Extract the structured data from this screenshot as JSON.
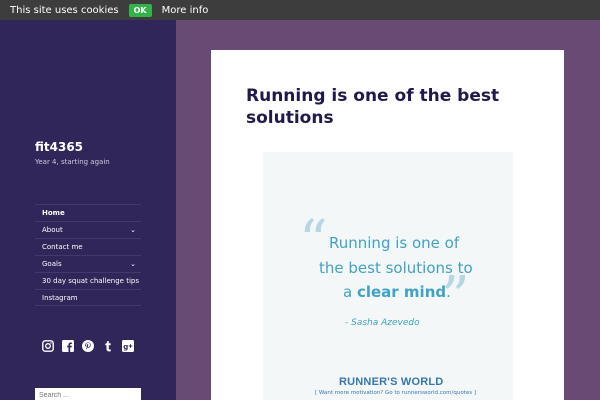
{
  "cookie_bar": {
    "text": "This site uses cookies",
    "ok_label": "OK",
    "more_label": "More info"
  },
  "site": {
    "title": "fit4365",
    "description": "Year 4, starting again"
  },
  "nav": {
    "items": [
      {
        "label": "Home",
        "active": true,
        "has_submenu": false
      },
      {
        "label": "About",
        "active": false,
        "has_submenu": true
      },
      {
        "label": "Contact me",
        "active": false,
        "has_submenu": false
      },
      {
        "label": "Goals",
        "active": false,
        "has_submenu": true
      },
      {
        "label": "30 day squat challenge tips",
        "active": false,
        "has_submenu": false
      },
      {
        "label": "Instagram",
        "active": false,
        "has_submenu": false
      }
    ],
    "submenu_icon": "chevron-down-icon"
  },
  "social": {
    "icons": [
      "instagram-icon",
      "facebook-icon",
      "pinterest-icon",
      "tumblr-icon",
      "google-plus-icon"
    ]
  },
  "search": {
    "placeholder": "Search ..."
  },
  "post": {
    "title": "Running is one of the best solutions",
    "image": {
      "quote_line1": "Running is one of",
      "quote_line2": "the best solutions to",
      "quote_line3_prefix": "a ",
      "quote_line3_bold": "clear mind",
      "quote_line3_suffix": ".",
      "author": "- Sasha Azevedo",
      "brand": "RUNNER'S WORLD",
      "brand_sub": "[ Want more motivation? Go to runnersworld.com/quotes ]"
    }
  },
  "colors": {
    "sidebar_bg": "#30265a",
    "page_bg": "#684a74",
    "title_color": "#21194a",
    "quote_color": "#41a2c3",
    "cookie_ok": "#33b24a"
  }
}
